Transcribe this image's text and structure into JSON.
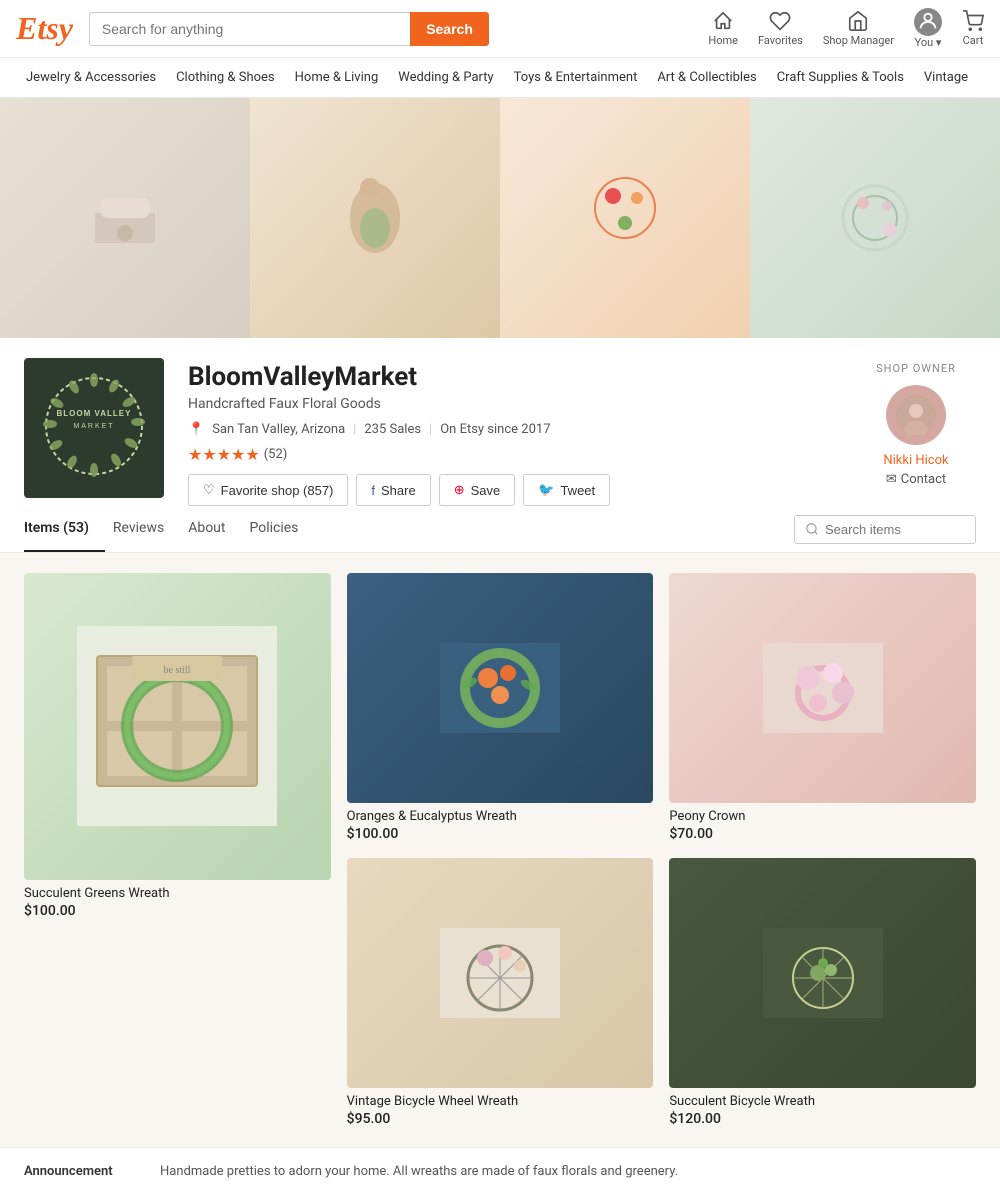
{
  "header": {
    "logo": "Etsy",
    "search_placeholder": "Search for anything",
    "search_button": "Search",
    "nav": [
      {
        "id": "home",
        "label": "Home",
        "icon": "home-icon"
      },
      {
        "id": "favorites",
        "label": "Favorites",
        "icon": "heart-icon"
      },
      {
        "id": "shop-manager",
        "label": "Shop Manager",
        "icon": "shop-icon"
      },
      {
        "id": "you",
        "label": "You ▾",
        "icon": "person-icon"
      },
      {
        "id": "cart",
        "label": "Cart",
        "icon": "cart-icon"
      }
    ]
  },
  "categories": [
    "Jewelry & Accessories",
    "Clothing & Shoes",
    "Home & Living",
    "Wedding & Party",
    "Toys & Entertainment",
    "Art & Collectibles",
    "Craft Supplies & Tools",
    "Vintage"
  ],
  "shop": {
    "name": "BloomValleyMarket",
    "subtitle": "Handcrafted Faux Floral Goods",
    "location": "San Tan Valley, Arizona",
    "sales": "235 Sales",
    "since": "On Etsy since 2017",
    "stars": "★★★★★",
    "rating_count": "(52)",
    "favorite_label": "Favorite shop (857)",
    "share_label": "Share",
    "save_label": "Save",
    "tweet_label": "Tweet"
  },
  "owner": {
    "label": "SHOP OWNER",
    "name": "Nikki Hicok",
    "contact_label": "Contact"
  },
  "tabs": [
    {
      "id": "items",
      "label": "Items (53)",
      "active": true
    },
    {
      "id": "reviews",
      "label": "Reviews",
      "active": false
    },
    {
      "id": "about",
      "label": "About",
      "active": false
    },
    {
      "id": "policies",
      "label": "Policies",
      "active": false
    }
  ],
  "search_items_placeholder": "Search items",
  "items": [
    {
      "id": "succulent-greens",
      "name": "Succulent Greens Wreath",
      "price": "$100.00",
      "large": true
    },
    {
      "id": "oranges-eucalyptus",
      "name": "Oranges & Eucalyptus Wreath",
      "price": "$100.00",
      "large": false
    },
    {
      "id": "peony-crown",
      "name": "Peony Crown",
      "price": "$70.00",
      "large": false
    },
    {
      "id": "vintage-bicycle",
      "name": "Vintage Bicycle Wheel Wreath",
      "price": "$95.00",
      "large": false
    },
    {
      "id": "succulent-bicycle",
      "name": "Succulent Bicycle Wreath",
      "price": "$120.00",
      "large": false
    }
  ],
  "announcement": {
    "label": "Announcement",
    "text": "Handmade pretties to adorn your home. All wreaths are made of faux florals and greenery."
  }
}
